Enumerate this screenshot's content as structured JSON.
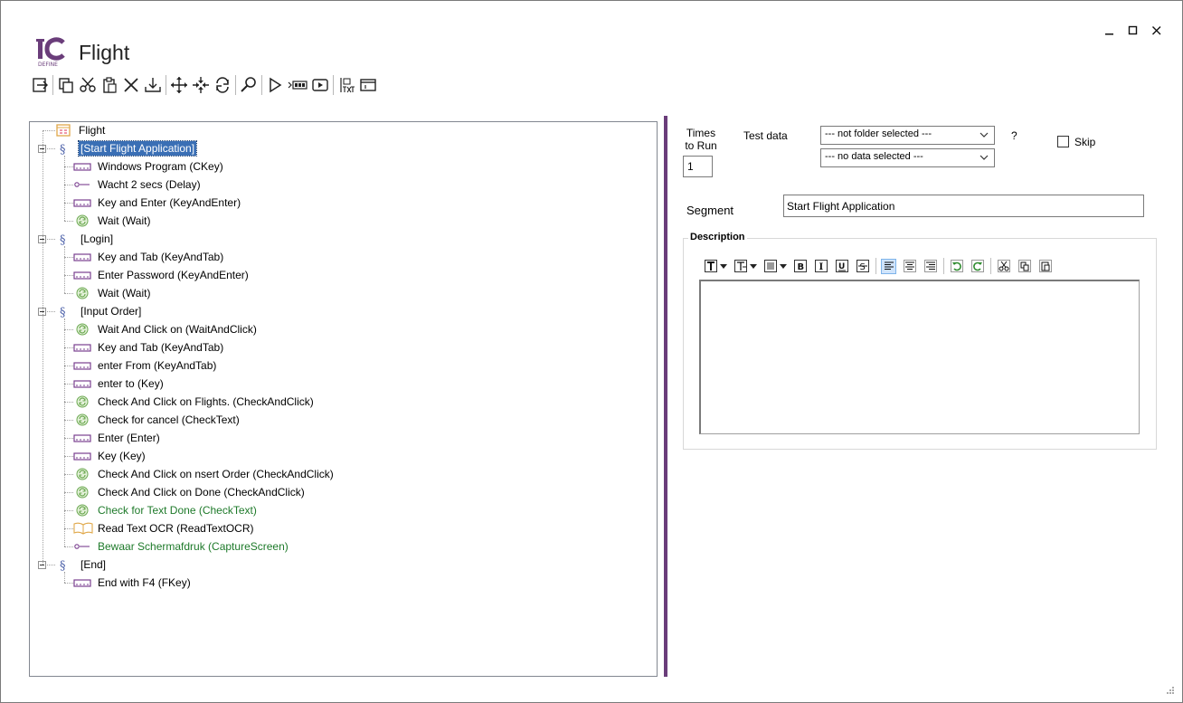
{
  "window": {
    "title": "Flight",
    "logo_text": "DEFINE",
    "controls": [
      "minimize",
      "maximize",
      "close"
    ]
  },
  "toolbar": {
    "groups": [
      [
        {
          "name": "exit-icon"
        }
      ],
      [
        {
          "name": "copy-icon"
        },
        {
          "name": "cut-icon"
        },
        {
          "name": "paste-icon"
        },
        {
          "name": "delete-icon"
        },
        {
          "name": "import-icon"
        }
      ],
      [
        {
          "name": "move-icon"
        },
        {
          "name": "collapse-icon"
        },
        {
          "name": "refresh-icon"
        }
      ],
      [
        {
          "name": "search-icon"
        }
      ],
      [
        {
          "name": "run-icon"
        },
        {
          "name": "record-icon"
        },
        {
          "name": "play-video-icon"
        }
      ],
      [
        {
          "name": "text-export-icon"
        },
        {
          "name": "window-icon"
        }
      ]
    ]
  },
  "tree": {
    "root": "Flight",
    "segments": [
      {
        "label": "[Start Flight Application]",
        "selected": true,
        "items": [
          {
            "label": "Windows Program (CKey)",
            "icon": "key"
          },
          {
            "label": "Wacht 2 secs (Delay)",
            "icon": "delay"
          },
          {
            "label": "Key and Enter (KeyAndEnter)",
            "icon": "key"
          },
          {
            "label": "Wait  (Wait)",
            "icon": "wait"
          }
        ]
      },
      {
        "label": "[Login]",
        "items": [
          {
            "label": "Key and Tab (KeyAndTab)",
            "icon": "key"
          },
          {
            "label": "Enter Password (KeyAndEnter)",
            "icon": "key"
          },
          {
            "label": "Wait  (Wait)",
            "icon": "wait"
          }
        ]
      },
      {
        "label": "[Input Order]",
        "items": [
          {
            "label": "Wait And Click on  (WaitAndClick)",
            "icon": "wait"
          },
          {
            "label": "Key and Tab (KeyAndTab)",
            "icon": "key"
          },
          {
            "label": "enter From (KeyAndTab)",
            "icon": "key"
          },
          {
            "label": "enter to (Key)",
            "icon": "key"
          },
          {
            "label": "Check And Click on Flights. (CheckAndClick)",
            "icon": "wait"
          },
          {
            "label": "Check for cancel (CheckText)",
            "icon": "wait"
          },
          {
            "label": "Enter (Enter)",
            "icon": "key"
          },
          {
            "label": "Key (Key)",
            "icon": "key"
          },
          {
            "label": "Check And Click on nsert Order (CheckAndClick)",
            "icon": "wait"
          },
          {
            "label": "Check And Click on Done (CheckAndClick)",
            "icon": "wait"
          },
          {
            "label": "Check for Text Done (CheckText)",
            "icon": "wait",
            "green": true
          },
          {
            "label": "Read Text OCR (ReadTextOCR)",
            "icon": "ocr"
          },
          {
            "label": "Bewaar Schermafdruk (CaptureScreen)",
            "icon": "delay",
            "green": true
          }
        ]
      },
      {
        "label": "[End]",
        "items": [
          {
            "label": "End with F4 (FKey)",
            "icon": "key"
          }
        ]
      }
    ]
  },
  "details": {
    "times_label_1": "Times",
    "times_label_2": "to Run",
    "times_value": "1",
    "test_data_label": "Test data",
    "folder_combo": "--- not folder selected ---",
    "data_combo": "--- no data selected ---",
    "help": "?",
    "skip_label": "Skip",
    "skip_checked": false,
    "segment_label": "Segment",
    "segment_value": "Start Flight Application",
    "description_label": "Description"
  },
  "colors": {
    "accent": "#6a3d7a",
    "selection": "#3a6fb5",
    "green_text": "#1e7a2a",
    "key_icon": "#7a3f8f",
    "wait_icon": "#6aa84f",
    "ocr_icon": "#e0a84a"
  }
}
